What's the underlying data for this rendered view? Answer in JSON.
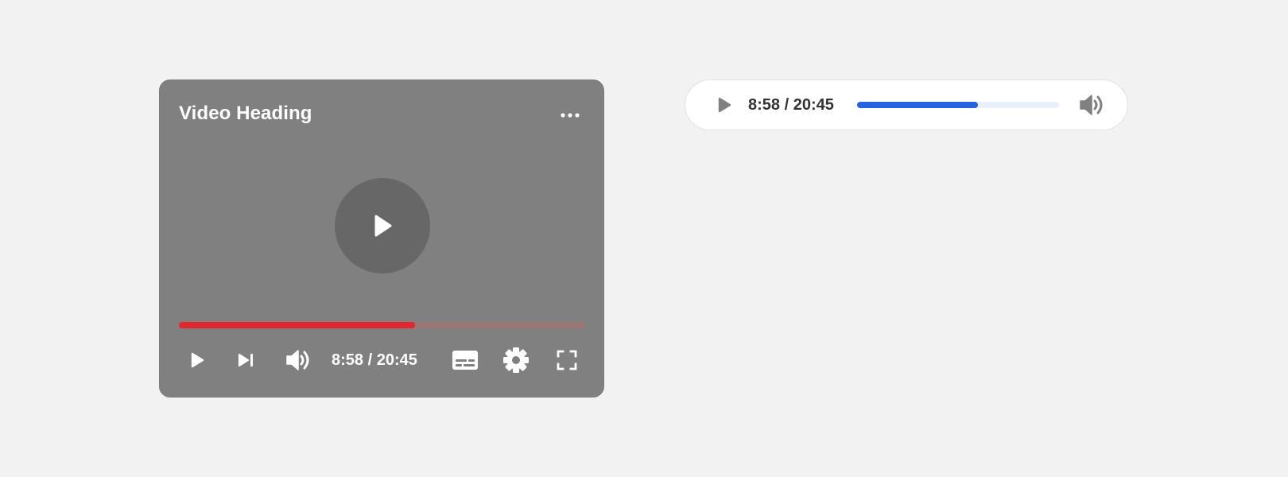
{
  "video_player": {
    "heading": "Video Heading",
    "time": "8:58 / 20:45",
    "progress": 0.58,
    "colors": {
      "background": "#808080",
      "progress_fill": "#e0262f",
      "progress_track": "#9a7676",
      "big_play_bg": "#676767",
      "icon": "#ffffff"
    },
    "icons": {
      "menu": "more-horizontal-icon",
      "center": "play-icon",
      "play": "play-icon",
      "next": "skip-next-icon",
      "volume": "volume-icon",
      "subtitles": "subtitles-icon",
      "settings": "gear-icon",
      "fullscreen": "fullscreen-icon"
    }
  },
  "audio_player": {
    "time": "8:58 / 20:45",
    "progress": 0.6,
    "colors": {
      "background": "#ffffff",
      "progress_fill": "#2563e0",
      "progress_track": "#e9f0fb",
      "icon": "#808080",
      "text": "#333333"
    },
    "icons": {
      "play": "play-icon",
      "volume": "volume-icon"
    }
  }
}
